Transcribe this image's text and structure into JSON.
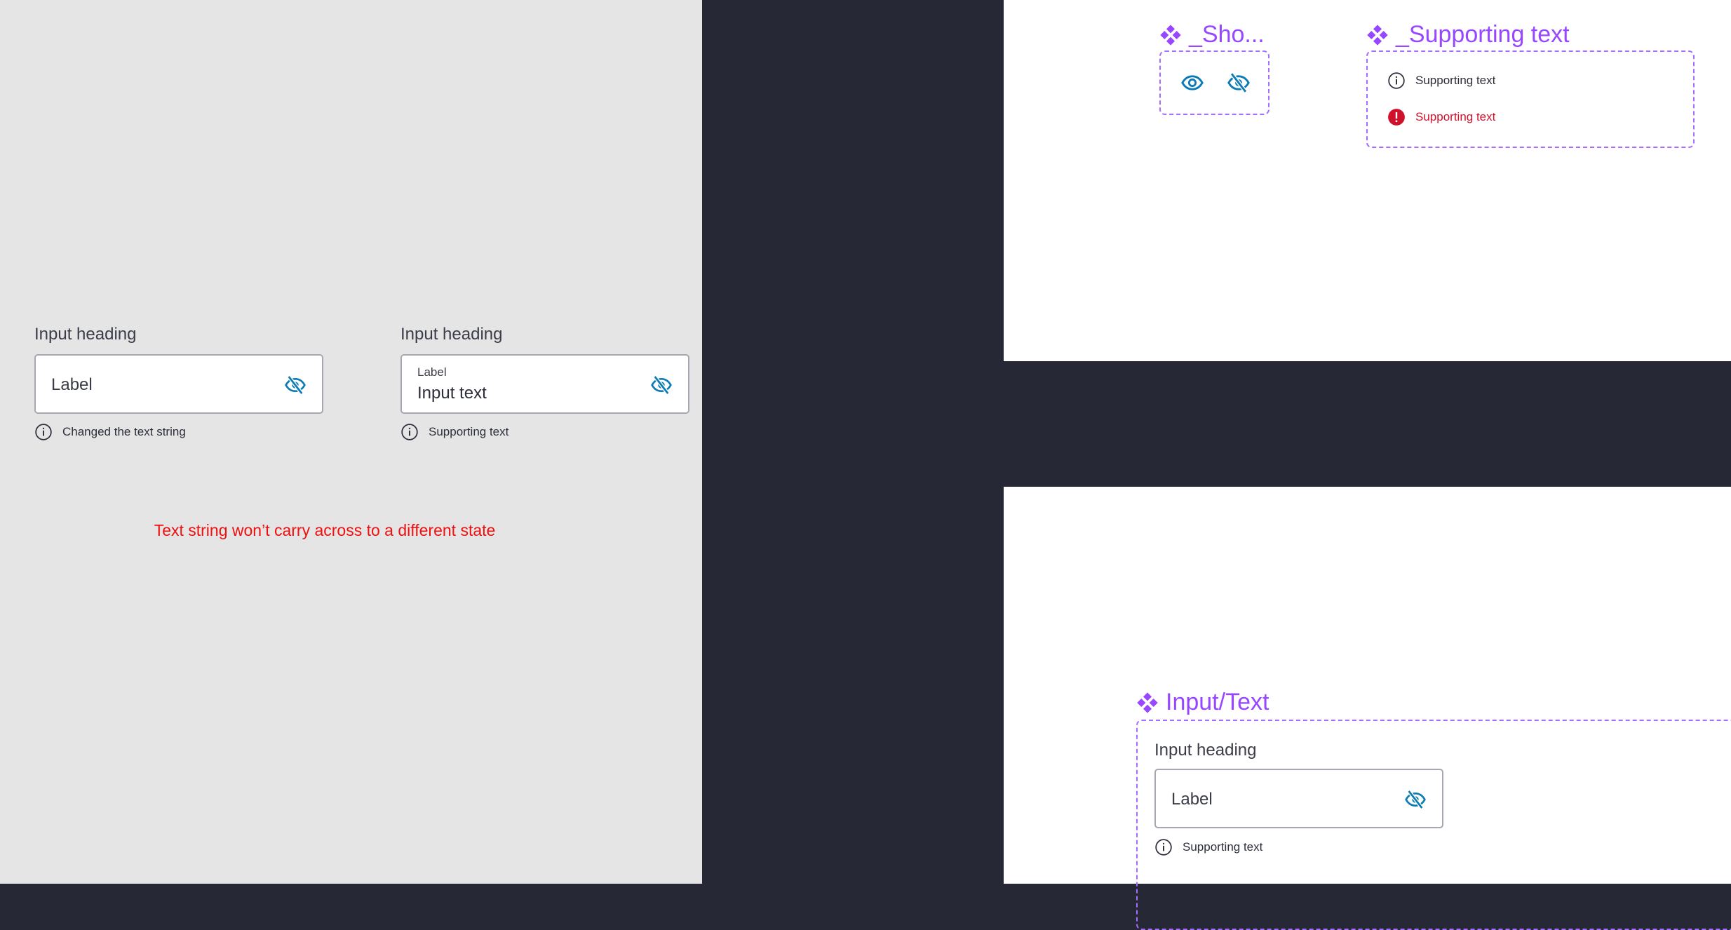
{
  "left_panel": {
    "examples": [
      {
        "heading": "Input heading",
        "placeholder": "Label",
        "helper": "Changed the text string",
        "icon": "eye-off-icon"
      },
      {
        "heading": "Input heading",
        "label": "Label",
        "value": "Input text",
        "helper": "Supporting text",
        "icon": "eye-off-icon"
      }
    ],
    "note": "Text string won’t carry across to a different state"
  },
  "components": {
    "show_hide": {
      "title": "_Sho...",
      "icons": [
        "eye-icon",
        "eye-off-icon"
      ]
    },
    "supporting_text": {
      "title": "_Supporting text",
      "rows": [
        {
          "text": "Supporting text",
          "icon": "info-icon",
          "state": "default"
        },
        {
          "text": "Supporting text",
          "icon": "error-icon",
          "state": "error"
        }
      ]
    },
    "input_text": {
      "title": "Input/Text",
      "heading": "Input heading",
      "placeholder": "Label",
      "helper": "Supporting text"
    }
  },
  "colors": {
    "component_purple": "#9747ff",
    "icon_blue": "#0a7bb5",
    "error_red": "#d0112b",
    "note_red": "#ee1111",
    "canvas": "#262835"
  }
}
